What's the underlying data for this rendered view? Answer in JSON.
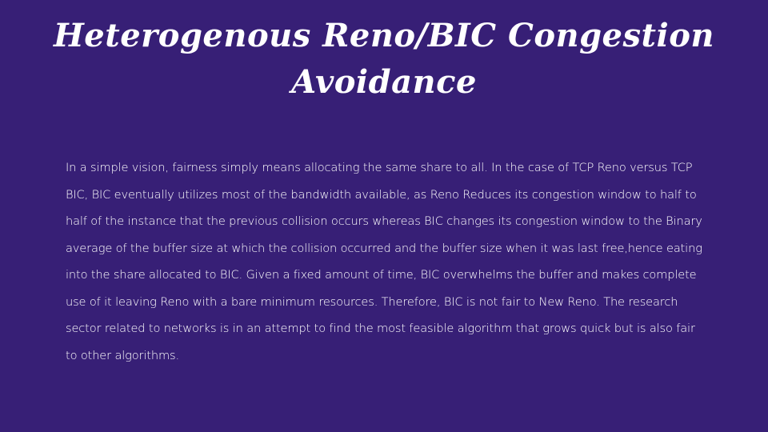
{
  "slide": {
    "title": "Heterogenous Reno/BIC Congestion Avoidance",
    "body": "In a simple vision, fairness simply means allocating the same share to all. In the case of TCP Reno versus TCP BIC, BIC eventually utilizes most of the bandwidth available, as Reno Reduces its congestion window to half to half of the instance that the previous collision occurs whereas BIC changes its congestion window to the Binary average of the  buffer size at which the collision occurred and the buffer size when it was last free,hence eating into the share allocated to BIC. Given a fixed amount of time, BIC overwhelms the buffer and makes complete use of it leaving Reno with a bare minimum resources. Therefore, BIC is not fair to New Reno. The research sector related to networks is in an attempt to find the most feasible algorithm that grows quick but is also fair to other algorithms.",
    "background_color": "#371f76",
    "text_color": "#ffffff"
  }
}
